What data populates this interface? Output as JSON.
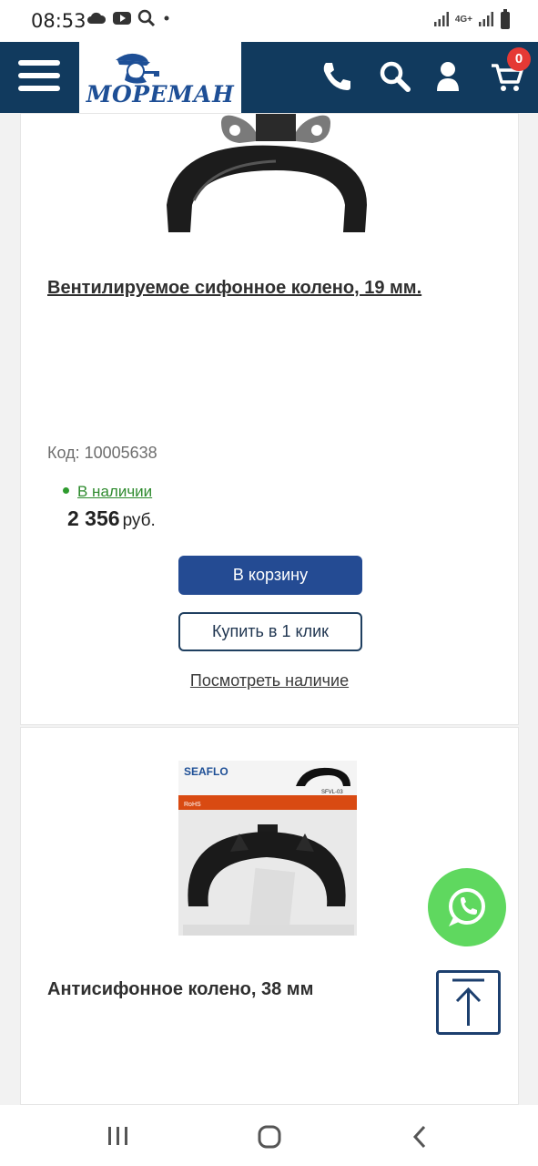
{
  "status_bar": {
    "time": "08:53",
    "network_label": "4G+",
    "icons": [
      "cloud-icon",
      "youtube-icon",
      "search-icon",
      "dot-icon",
      "signal-icon",
      "signal-icon",
      "battery-icon"
    ]
  },
  "header": {
    "logo_text": "МОРЕМАН",
    "cart_count": "0",
    "icons": [
      "menu-icon",
      "phone-icon",
      "search-icon",
      "user-icon",
      "cart-icon"
    ]
  },
  "products": [
    {
      "title": "Вентилируемое сифонное колено, 19 мм.",
      "code": "Код: 10005638",
      "stock": "В наличии",
      "price": "2 356",
      "currency": "руб.",
      "cart_button": "В корзину",
      "one_click_button": "Купить в 1 клик",
      "check_availability": "Посмотреть наличие"
    },
    {
      "title": "Антисифонное колено, 38 мм",
      "package_brand": "SEAFLO",
      "package_model": "SFVL-03",
      "package_rohs": "RoHS"
    }
  ],
  "colors": {
    "header_bg": "#113a5e",
    "primary_button": "#244b93",
    "stock_green": "#2e8b2e",
    "whatsapp_green": "#5fd85f",
    "badge_red": "#e53935"
  }
}
